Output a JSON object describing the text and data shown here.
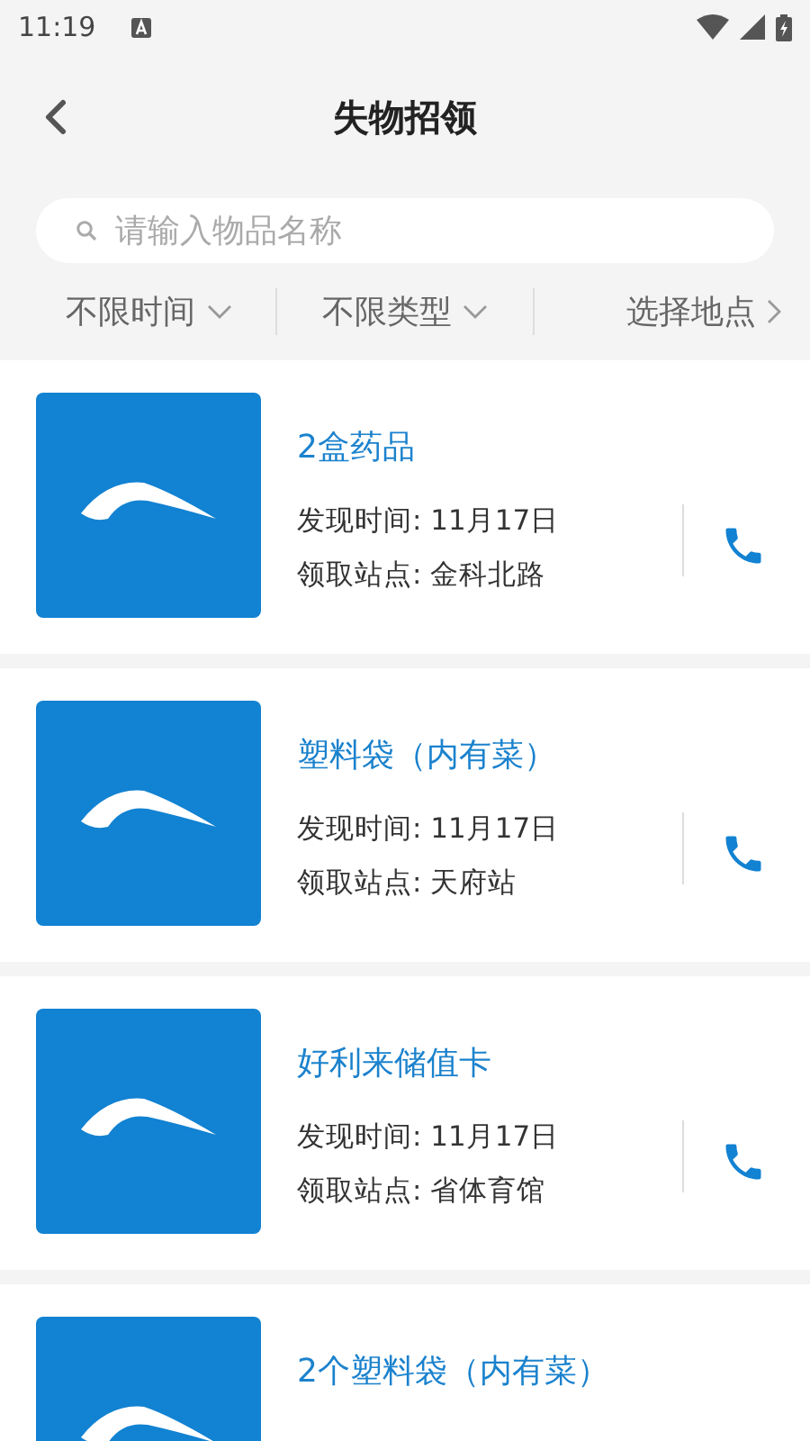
{
  "status_bar": {
    "time": "11:19"
  },
  "header": {
    "title": "失物招领"
  },
  "search": {
    "placeholder": "请输入物品名称"
  },
  "filters": [
    {
      "label": "不限时间",
      "kind": "dropdown"
    },
    {
      "label": "不限类型",
      "kind": "dropdown"
    },
    {
      "label": "选择地点",
      "kind": "link"
    }
  ],
  "items": [
    {
      "title": "2盒药品",
      "found_time": "发现时间: 11月17日",
      "station": "领取站点: 金科北路"
    },
    {
      "title": "塑料袋（内有菜）",
      "found_time": "发现时间: 11月17日",
      "station": "领取站点: 天府站"
    },
    {
      "title": "好利来储值卡",
      "found_time": "发现时间: 11月17日",
      "station": "领取站点: 省体育馆"
    },
    {
      "title": "2个塑料袋（内有菜）"
    }
  ]
}
